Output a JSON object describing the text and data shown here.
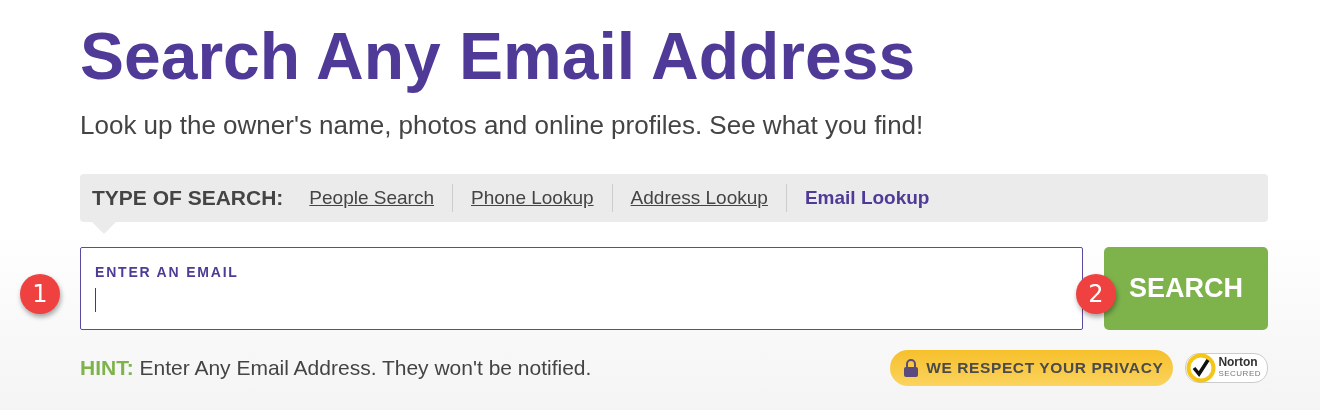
{
  "title": "Search Any Email Address",
  "subtitle": "Look up the owner's name, photos and online profiles. See what you find!",
  "search_types": {
    "label": "TYPE OF SEARCH:",
    "items": [
      {
        "label": "People Search",
        "selected": false
      },
      {
        "label": "Phone Lookup",
        "selected": false
      },
      {
        "label": "Address Lookup",
        "selected": false
      },
      {
        "label": "Email Lookup",
        "selected": true
      }
    ]
  },
  "email_field": {
    "label": "ENTER AN EMAIL"
  },
  "search_button": "SEARCH",
  "callouts": [
    "1",
    "2"
  ],
  "hint": {
    "label": "HINT:",
    "text": "Enter Any Email Address. They won't be notified."
  },
  "privacy_badge": "WE RESPECT YOUR PRIVACY",
  "norton_seal": {
    "name": "Norton",
    "sub": "SECURED"
  }
}
